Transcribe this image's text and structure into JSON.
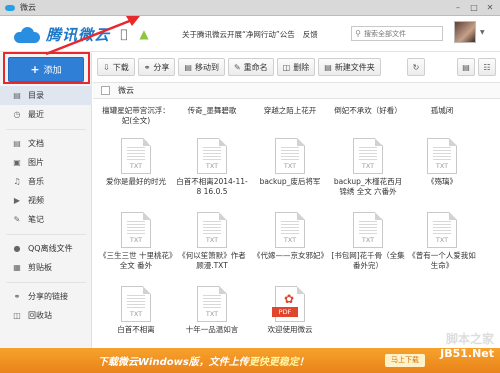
{
  "window": {
    "title": "微云",
    "minimize": "–",
    "maximize": "□",
    "close": "✕"
  },
  "header": {
    "logo_text": "腾讯微云",
    "links": [
      "关于腾讯微云开展“净网行动”公告",
      "反馈"
    ],
    "search_placeholder": "搜索全部文件"
  },
  "sidebar": {
    "add_label": "添加",
    "items": [
      {
        "label": "目录",
        "icon": "folder-icon"
      },
      {
        "label": "最近",
        "icon": "clock-icon"
      },
      {
        "label": "文档",
        "icon": "document-icon"
      },
      {
        "label": "图片",
        "icon": "image-icon"
      },
      {
        "label": "音乐",
        "icon": "music-icon"
      },
      {
        "label": "视频",
        "icon": "video-icon"
      },
      {
        "label": "笔记",
        "icon": "note-icon"
      },
      {
        "label": "QQ离线文件",
        "icon": "qq-icon"
      },
      {
        "label": "剪贴板",
        "icon": "clipboard-icon"
      },
      {
        "label": "分享的链接",
        "icon": "share-link-icon"
      },
      {
        "label": "回收站",
        "icon": "trash-icon"
      }
    ]
  },
  "toolbar": {
    "download": "下载",
    "share": "分享",
    "move": "移动到",
    "rename": "重命名",
    "delete": "删除",
    "new_folder": "新建文件夹"
  },
  "breadcrumb": {
    "current": "微云"
  },
  "files": {
    "top_row": [
      "檀罐星妃带宫沉浮：妃(全文)",
      "传奇_墨舞碧歌",
      "穿越之陌上花开",
      "倒妃不承欢（好看）",
      "孤城闭"
    ],
    "rows": [
      [
        {
          "name": "爱你是最好的时光",
          "ext": "TXT"
        },
        {
          "name": "白首不相离2014-11-8 16.0.5",
          "ext": "TXT"
        },
        {
          "name": "backup_废后将军",
          "ext": "TXT"
        },
        {
          "name": "backup_木槿花西月锦绣 全文 六番外",
          "ext": "TXT"
        },
        {
          "name": "《殇璃》",
          "ext": "TXT"
        }
      ],
      [
        {
          "name": "《三生三世 十里桃花》全文 番外",
          "ext": "TXT"
        },
        {
          "name": "《何以笙箫默》作者 顾漫.TXT",
          "ext": "TXT"
        },
        {
          "name": "《代嫁——京女邪妃》",
          "ext": "TXT"
        },
        {
          "name": "[书包网]花千骨（全集 番外完）",
          "ext": "TXT"
        },
        {
          "name": "《曾有一个人爱我如生命》",
          "ext": "TXT"
        }
      ],
      [
        {
          "name": "白首不相离",
          "ext": "TXT"
        },
        {
          "name": "十年一品温如言",
          "ext": "TXT"
        },
        {
          "name": "欢迎使用微云",
          "ext": "PDF"
        }
      ]
    ]
  },
  "banner": {
    "text_a": "下载微云Windows版，文件上传",
    "text_b": "更快更稳定",
    "text_c": "！",
    "button": "马上下载"
  },
  "watermark": {
    "line1": "脚本之家",
    "line2": "JB51.Net"
  }
}
